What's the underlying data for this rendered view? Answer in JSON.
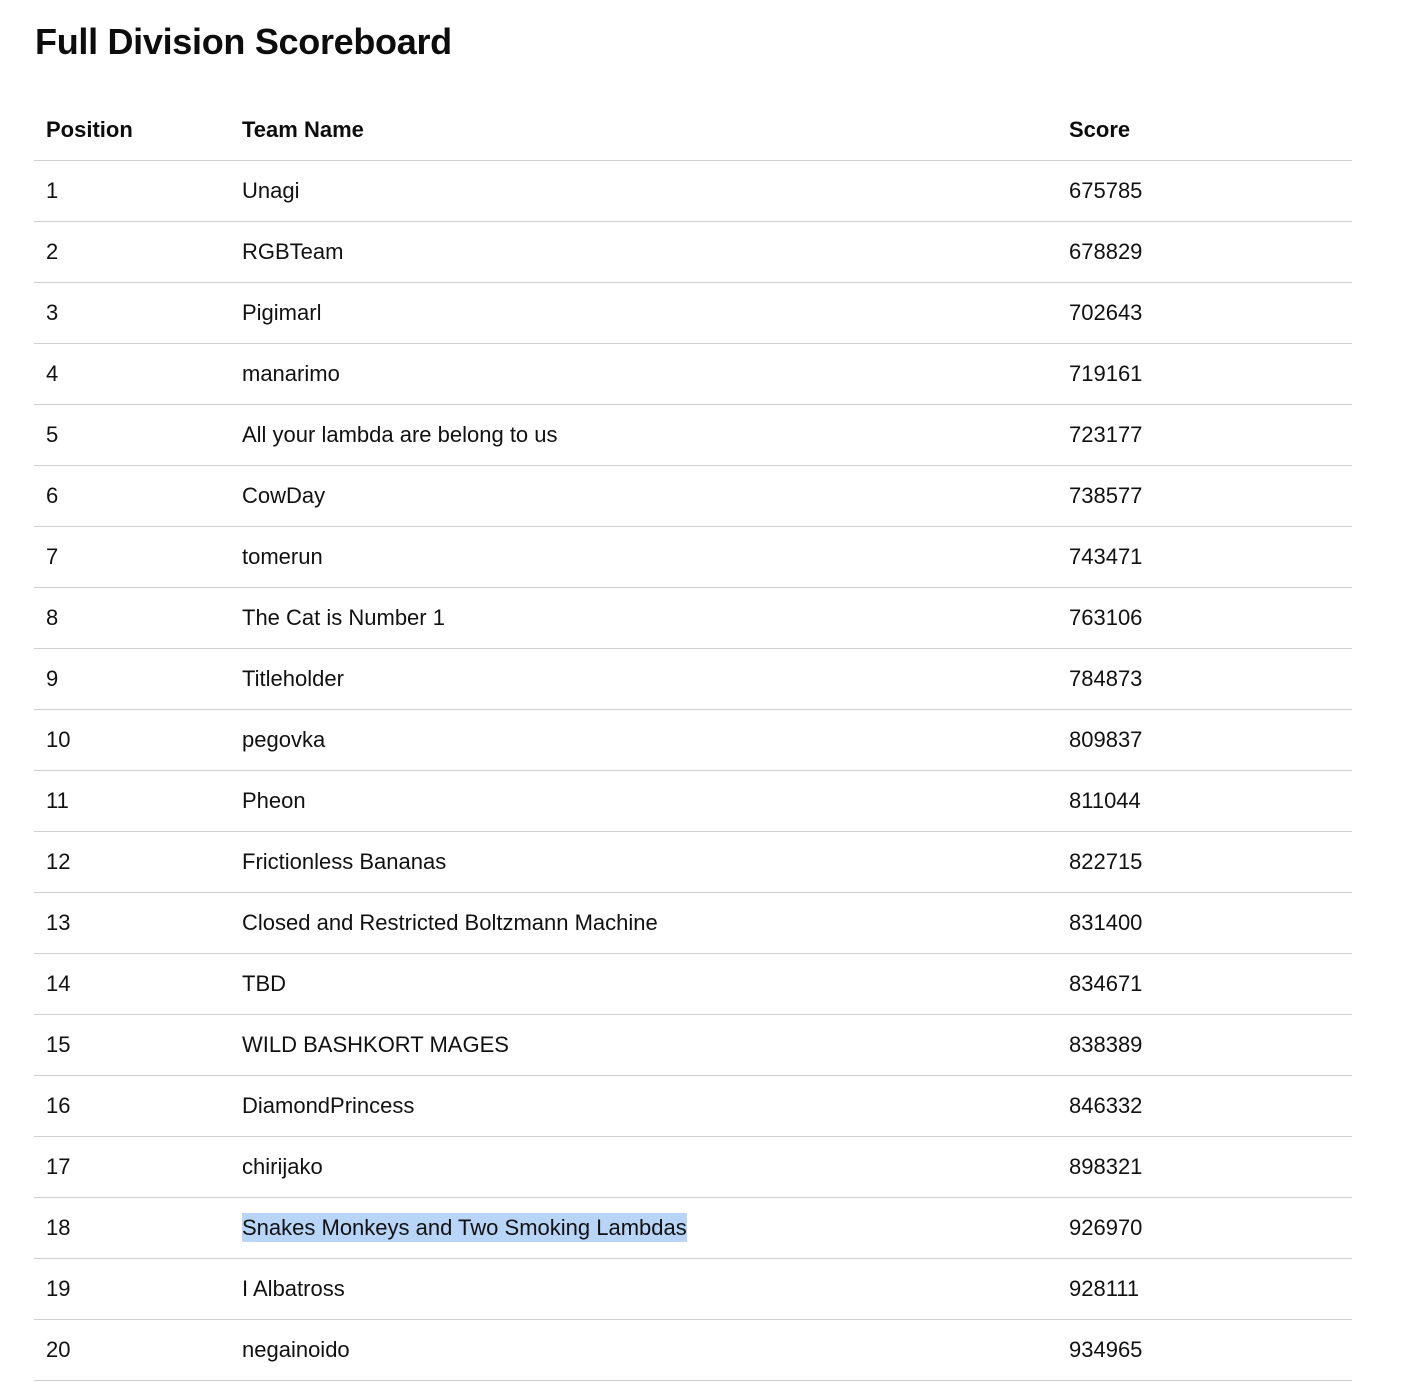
{
  "page": {
    "title": "Full Division Scoreboard"
  },
  "table": {
    "headers": {
      "position": "Position",
      "team_name": "Team Name",
      "score": "Score"
    },
    "rows": [
      {
        "position": "1",
        "team_name": "Unagi",
        "score": "675785"
      },
      {
        "position": "2",
        "team_name": "RGBTeam",
        "score": "678829"
      },
      {
        "position": "3",
        "team_name": "Pigimarl",
        "score": "702643"
      },
      {
        "position": "4",
        "team_name": "manarimo",
        "score": "719161"
      },
      {
        "position": "5",
        "team_name": "All your lambda are belong to us",
        "score": "723177"
      },
      {
        "position": "6",
        "team_name": "CowDay",
        "score": "738577"
      },
      {
        "position": "7",
        "team_name": "tomerun",
        "score": "743471"
      },
      {
        "position": "8",
        "team_name": "The Cat is Number 1",
        "score": "763106"
      },
      {
        "position": "9",
        "team_name": "Titleholder",
        "score": "784873"
      },
      {
        "position": "10",
        "team_name": "pegovka",
        "score": "809837"
      },
      {
        "position": "11",
        "team_name": "Pheon",
        "score": "811044"
      },
      {
        "position": "12",
        "team_name": "Frictionless Bananas",
        "score": "822715"
      },
      {
        "position": "13",
        "team_name": "Closed and Restricted Boltzmann Machine",
        "score": "831400"
      },
      {
        "position": "14",
        "team_name": "TBD",
        "score": "834671"
      },
      {
        "position": "15",
        "team_name": "WILD BASHKORT MAGES",
        "score": "838389"
      },
      {
        "position": "16",
        "team_name": "DiamondPrincess",
        "score": "846332"
      },
      {
        "position": "17",
        "team_name": "chirijako",
        "score": "898321"
      },
      {
        "position": "18",
        "team_name": "Snakes Monkeys and Two Smoking Lambdas",
        "score": "926970",
        "selected": true
      },
      {
        "position": "19",
        "team_name": "I Albatross",
        "score": "928111"
      },
      {
        "position": "20",
        "team_name": "negainoido",
        "score": "934965"
      }
    ]
  },
  "colors": {
    "selection_highlight": "#b8d5f8",
    "row_divider": "#cfcfcf",
    "text": "#111111"
  }
}
